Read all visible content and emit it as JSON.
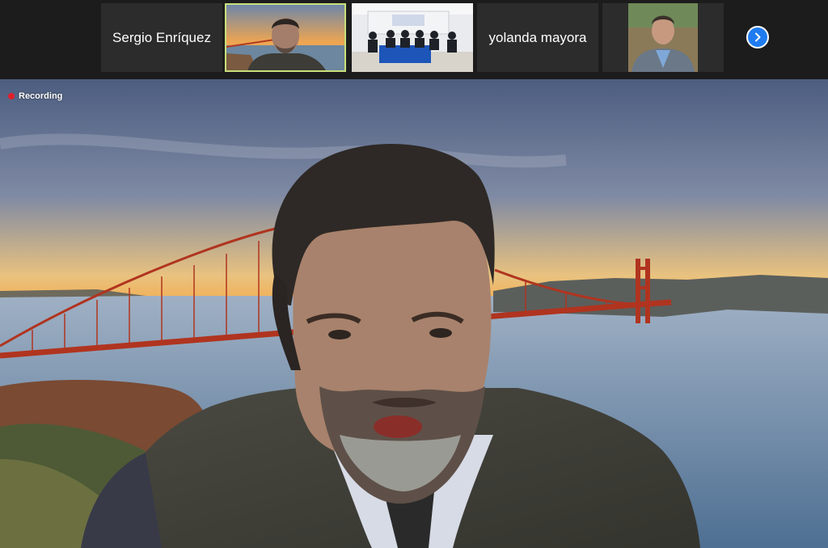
{
  "participants": [
    {
      "name": "Sergio Enríquez",
      "type": "name-only"
    },
    {
      "name": "",
      "type": "video",
      "active": true
    },
    {
      "name": "",
      "type": "video"
    },
    {
      "name": "yolanda mayora",
      "type": "name-only"
    },
    {
      "name": "",
      "type": "video"
    }
  ],
  "next_page_icon": "chevron-right-icon",
  "recording": {
    "label": "Recording",
    "color": "#e0202a"
  },
  "colors": {
    "accent": "#1f7cf0",
    "active_border": "#c9e07a",
    "bar_bg": "#1c1c1c"
  }
}
